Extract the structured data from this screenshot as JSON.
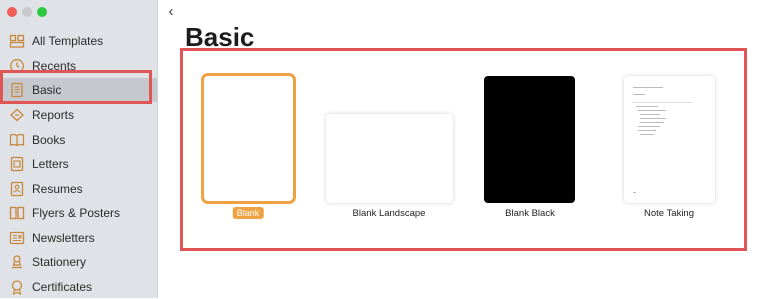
{
  "sidebar": {
    "items": [
      {
        "label": "All Templates",
        "icon": "all-templates-icon"
      },
      {
        "label": "Recents",
        "icon": "clock-icon"
      },
      {
        "label": "Basic",
        "icon": "document-icon"
      },
      {
        "label": "Reports",
        "icon": "reports-icon"
      },
      {
        "label": "Books",
        "icon": "book-icon"
      },
      {
        "label": "Letters",
        "icon": "letter-icon"
      },
      {
        "label": "Resumes",
        "icon": "resume-icon"
      },
      {
        "label": "Flyers & Posters",
        "icon": "flyers-icon"
      },
      {
        "label": "Newsletters",
        "icon": "newsletter-icon"
      },
      {
        "label": "Stationery",
        "icon": "stationery-icon"
      },
      {
        "label": "Certificates",
        "icon": "certificate-icon"
      }
    ],
    "selected_label": "Basic"
  },
  "main": {
    "title": "Basic",
    "back_icon": "chevron-left-icon",
    "templates": [
      {
        "label": "Blank",
        "selected": true
      },
      {
        "label": "Blank Landscape"
      },
      {
        "label": "Blank Black"
      },
      {
        "label": "Note Taking"
      }
    ]
  },
  "colors": {
    "accent": "#f0a141",
    "highlight": "#e05555",
    "sidebar_bg": "#dfe2e6",
    "icon": "#c8873a"
  }
}
